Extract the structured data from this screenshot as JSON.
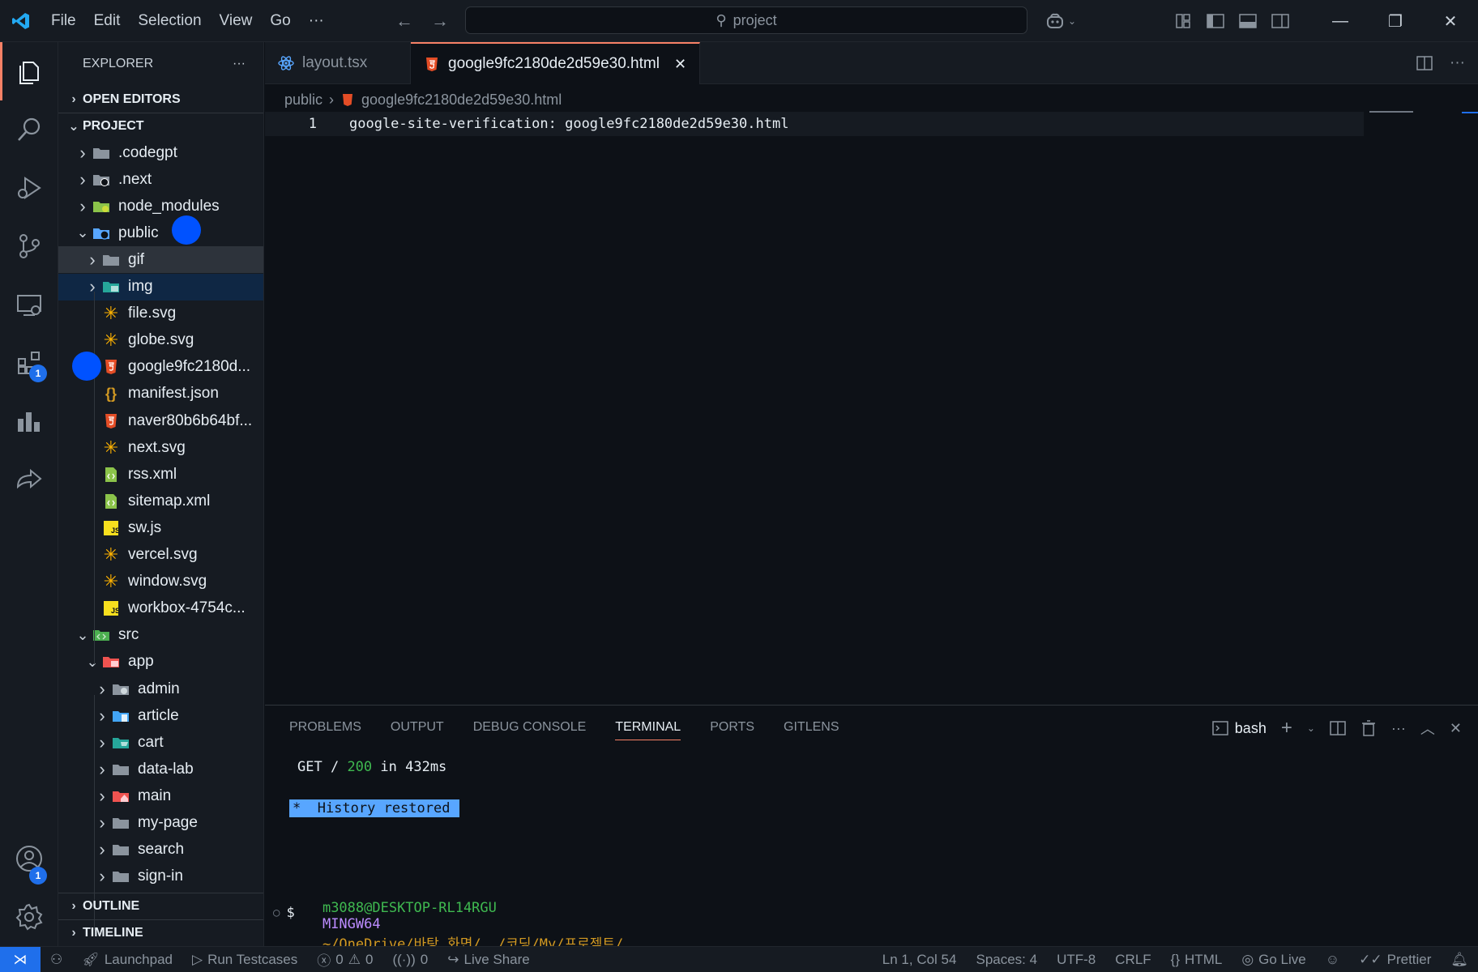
{
  "titlebar": {
    "menu": [
      "File",
      "Edit",
      "Selection",
      "View",
      "Go",
      "···"
    ],
    "search_text": "project",
    "colors": {
      "logo": "#23a9f2"
    }
  },
  "activity_bar": {
    "icons": [
      "explorer-icon",
      "search-icon",
      "run-debug-icon",
      "source-control-icon",
      "remote-explorer-icon",
      "extensions-icon",
      "chart-icon",
      "live-share-icon",
      "account-icon",
      "settings-icon"
    ],
    "extensions_badge": "1",
    "account_badge": "1"
  },
  "sidebar": {
    "title": "EXPLORER",
    "more": "···",
    "open_editors": "OPEN EDITORS",
    "project": "PROJECT",
    "outline": "OUTLINE",
    "timeline": "TIMELINE",
    "tree": [
      {
        "label": ".codegpt",
        "type": "folder"
      },
      {
        "label": ".next",
        "type": "folder-next"
      },
      {
        "label": "node_modules",
        "type": "folder-node"
      },
      {
        "label": "public",
        "type": "folder-public"
      },
      {
        "label": "gif",
        "type": "folder"
      },
      {
        "label": "img",
        "type": "folder-img"
      },
      {
        "label": "file.svg",
        "type": "svg"
      },
      {
        "label": "globe.svg",
        "type": "svg"
      },
      {
        "label": "google9fc2180d...",
        "type": "html"
      },
      {
        "label": "manifest.json",
        "type": "json"
      },
      {
        "label": "naver80b6b64bf...",
        "type": "html"
      },
      {
        "label": "next.svg",
        "type": "svg"
      },
      {
        "label": "rss.xml",
        "type": "xml"
      },
      {
        "label": "sitemap.xml",
        "type": "xml"
      },
      {
        "label": "sw.js",
        "type": "js"
      },
      {
        "label": "vercel.svg",
        "type": "svg"
      },
      {
        "label": "window.svg",
        "type": "svg"
      },
      {
        "label": "workbox-4754c...",
        "type": "js"
      },
      {
        "label": "src",
        "type": "folder-src"
      },
      {
        "label": "app",
        "type": "folder-app"
      },
      {
        "label": "admin",
        "type": "folder-admin"
      },
      {
        "label": "article",
        "type": "folder-article"
      },
      {
        "label": "cart",
        "type": "folder-cart"
      },
      {
        "label": "data-lab",
        "type": "folder"
      },
      {
        "label": "main",
        "type": "folder-main"
      },
      {
        "label": "my-page",
        "type": "folder"
      },
      {
        "label": "search",
        "type": "folder"
      },
      {
        "label": "sign-in",
        "type": "folder"
      }
    ]
  },
  "editor": {
    "tabs": [
      {
        "label": "layout.tsx",
        "active": false
      },
      {
        "label": "google9fc2180de2d59e30.html",
        "active": true
      }
    ],
    "breadcrumb": [
      "public",
      "google9fc2180de2d59e30.html"
    ],
    "line_number": "1",
    "code": "google-site-verification: google9fc2180de2d59e30.html"
  },
  "panel": {
    "tabs": [
      "PROBLEMS",
      "OUTPUT",
      "DEBUG CONSOLE",
      "TERMINAL",
      "PORTS",
      "GITLENS"
    ],
    "active_tab": "TERMINAL",
    "shell": "bash",
    "terminal": {
      "get_method": "GET /",
      "get_status": "200",
      "get_time": "in 432ms",
      "history": "*  History restored",
      "prompt_user": "m3088@DESKTOP-RL14RGU",
      "prompt_env": "MINGW64",
      "prompt_path": "~/OneDrive/바탕 화면/  /코딩/My/프로젝트/",
      "prompt_symbol": "$"
    }
  },
  "statusbar": {
    "launchpad": "Launchpad",
    "run_testcases": "Run Testcases",
    "errors": "0",
    "warnings": "0",
    "ports": "0",
    "live_share": "Live Share",
    "position": "Ln 1, Col 54",
    "spaces": "Spaces: 4",
    "encoding": "UTF-8",
    "eol": "CRLF",
    "language": "HTML",
    "go_live": "Go Live",
    "prettier": "Prettier"
  }
}
